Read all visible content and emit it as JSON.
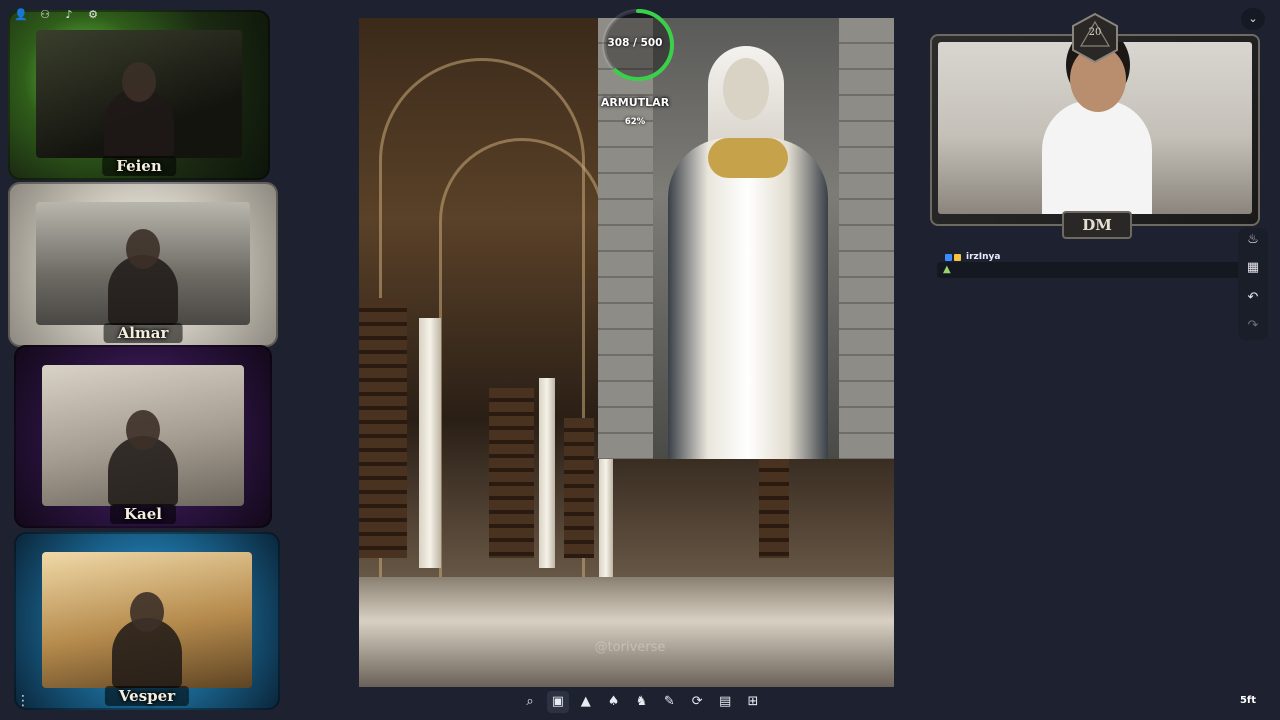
{
  "players": [
    {
      "name": "Feien",
      "frame_theme": "green-skull"
    },
    {
      "name": "Almar",
      "frame_theme": "white-feather"
    },
    {
      "name": "Kael",
      "frame_theme": "purple-moon"
    },
    {
      "name": "Vesper",
      "frame_theme": "blue-crystal"
    }
  ],
  "token": {
    "hp_text": "308 / 500",
    "hp_fraction": 0.616,
    "name": "ARMUTLAR",
    "percent": "62%"
  },
  "scene": {
    "watermark": "@toriverse"
  },
  "dm": {
    "label": "DM",
    "d20_number": "20"
  },
  "chat": {
    "username": "irzInya",
    "emote": "▲"
  },
  "bottom_toolbar": {
    "scale": "5ft"
  },
  "colors": {
    "background": "#1e2230",
    "hp_ring": "#3ad14a",
    "chat_username": "#e9e9ff"
  },
  "icons": {
    "top_left": [
      "user-icon",
      "users-icon",
      "music-icon",
      "settings-icon"
    ],
    "bottom": [
      "search-icon",
      "image-icon",
      "mountain-icon",
      "bell-icon",
      "horse-icon",
      "pencil-icon",
      "refresh-icon",
      "note-icon",
      "grid-icon"
    ],
    "right": [
      "fire-icon",
      "building-icon",
      "undo-icon",
      "redo-icon"
    ]
  }
}
